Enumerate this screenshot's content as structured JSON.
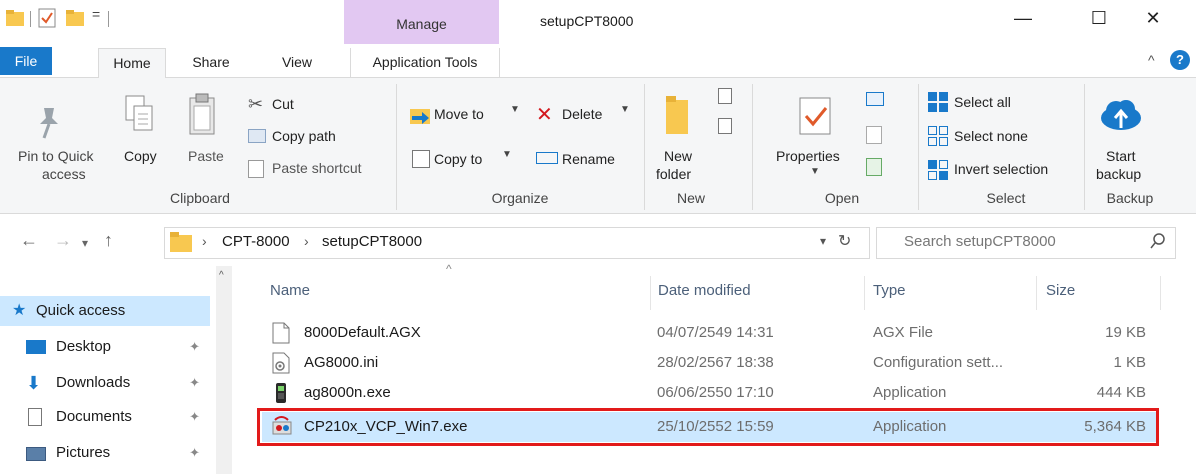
{
  "window": {
    "title": "setupCPT8000",
    "context_tab": "Manage",
    "controls": {
      "minimize": "—",
      "maximize": "☐",
      "close": "✕"
    }
  },
  "ribbon_tabs": [
    "File",
    "Home",
    "Share",
    "View",
    "Application Tools"
  ],
  "ribbon": {
    "clipboard": {
      "group": "Clipboard",
      "pin_label_line1": "Pin to Quick",
      "pin_label_line2": "access",
      "copy": "Copy",
      "paste": "Paste",
      "cut": "Cut",
      "copy_path": "Copy path",
      "paste_shortcut": "Paste shortcut"
    },
    "organize": {
      "group": "Organize",
      "move_to": "Move to",
      "copy_to": "Copy to",
      "delete": "Delete",
      "rename": "Rename"
    },
    "new": {
      "group": "New",
      "new_folder_line1": "New",
      "new_folder_line2": "folder"
    },
    "open": {
      "group": "Open",
      "properties": "Properties"
    },
    "select": {
      "group": "Select",
      "select_all": "Select all",
      "select_none": "Select none",
      "invert_selection": "Invert selection"
    },
    "backup": {
      "group": "Backup",
      "start_line1": "Start",
      "start_line2": "backup"
    }
  },
  "address": {
    "breadcrumb": [
      "CPT-8000",
      "setupCPT8000"
    ],
    "search_placeholder": "Search setupCPT8000"
  },
  "nav_pane": {
    "items": [
      {
        "label": "Quick access",
        "icon": "star-icon"
      },
      {
        "label": "Desktop",
        "icon": "desktop-folder-icon"
      },
      {
        "label": "Downloads",
        "icon": "download-arrow-icon"
      },
      {
        "label": "Documents",
        "icon": "documents-icon"
      },
      {
        "label": "Pictures",
        "icon": "pictures-icon"
      }
    ]
  },
  "file_list": {
    "columns": [
      "Name",
      "Date modified",
      "Type",
      "Size"
    ],
    "rows": [
      {
        "name": "8000Default.AGX",
        "date": "04/07/2549 14:31",
        "type": "AGX File",
        "size": "19 KB",
        "icon": "blank-file-icon"
      },
      {
        "name": "AG8000.ini",
        "date": "28/02/2567 18:38",
        "type": "Configuration sett...",
        "size": "1 KB",
        "icon": "config-file-icon"
      },
      {
        "name": "ag8000n.exe",
        "date": "06/06/2550 17:10",
        "type": "Application",
        "size": "444 KB",
        "icon": "scanner-app-icon"
      },
      {
        "name": "CP210x_VCP_Win7.exe",
        "date": "25/10/2552 15:59",
        "type": "Application",
        "size": "5,364 KB",
        "icon": "installer-app-icon",
        "selected": true
      }
    ]
  },
  "colors": {
    "file_tab": "#1979ca",
    "manage_tab": "#e2c8f2",
    "selection": "#cce8ff",
    "highlight_border": "#e21a1a"
  }
}
